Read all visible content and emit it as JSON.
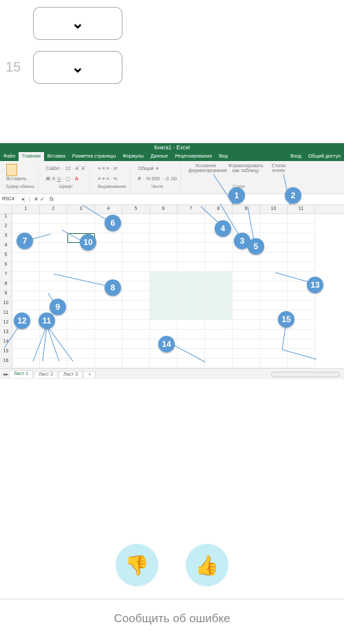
{
  "top": {
    "row1_num": "",
    "row2_num": "15"
  },
  "excel": {
    "title": "Книга1 - Excel",
    "tabs": {
      "file": "Файл",
      "home": "Главная",
      "insert": "Вставка",
      "layout": "Разметка страницы",
      "formulas": "Формулы",
      "data": "Данные",
      "review": "Рецензирование",
      "view": "Вид",
      "signin": "Вход",
      "share": "Общий доступ"
    },
    "ribbon": {
      "paste": "Вставить",
      "clipboard": "Буфер обмена",
      "font_name": "Calibri",
      "font_size": "12",
      "font_group": "Шрифт",
      "align_group": "Выравнивание",
      "number_fmt": "Общий",
      "number_pct": "% 000",
      "number_group": "Число",
      "cond_fmt": "Условное форматирование",
      "as_table": "Форматировать как таблицу",
      "cell_styles": "Стили ячеек",
      "styles_group": "Стили"
    },
    "namebox": "R5C4",
    "fx": "fx",
    "cols": [
      "1",
      "2",
      "3",
      "4",
      "5",
      "6",
      "7",
      "8",
      "9",
      "10",
      "11"
    ],
    "rowcount": 16,
    "sheets": [
      "Лист 1",
      "Лист 2",
      "Лист 3"
    ],
    "addsheet": "+"
  },
  "callouts": [
    "1",
    "2",
    "3",
    "4",
    "5",
    "6",
    "7",
    "8",
    "9",
    "10",
    "11",
    "12",
    "13",
    "14",
    "15"
  ],
  "footer": {
    "report": "Сообщить об ошибке"
  }
}
